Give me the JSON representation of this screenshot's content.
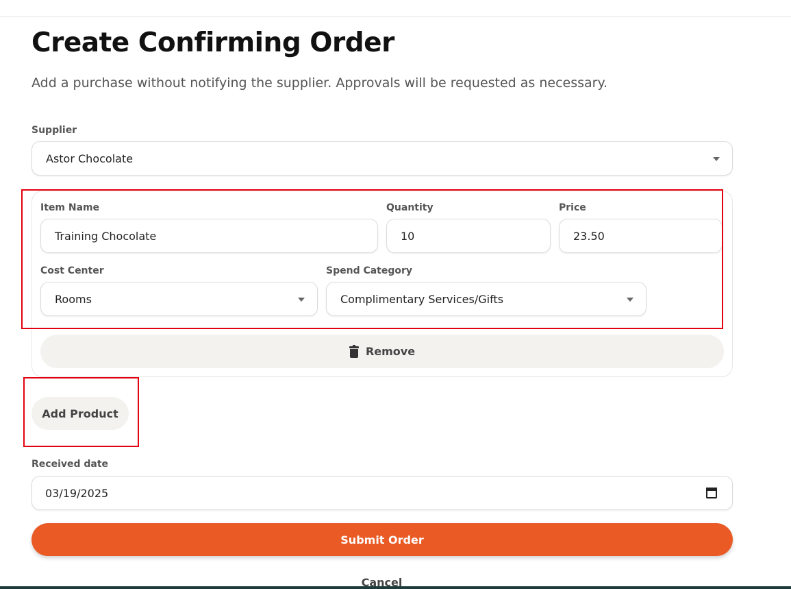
{
  "page": {
    "title": "Create Confirming Order",
    "subtitle": "Add a purchase without notifying the supplier. Approvals will be requested as necessary."
  },
  "supplier": {
    "label": "Supplier",
    "value": "Astor Chocolate"
  },
  "product": {
    "item_name_label": "Item Name",
    "item_name_value": "Training Chocolate",
    "quantity_label": "Quantity",
    "quantity_value": "10",
    "price_label": "Price",
    "price_value": "23.50",
    "cost_center_label": "Cost Center",
    "cost_center_value": "Rooms",
    "spend_category_label": "Spend Category",
    "spend_category_value": "Complimentary Services/Gifts",
    "remove_label": "Remove"
  },
  "actions": {
    "add_product_label": "Add Product",
    "submit_label": "Submit Order",
    "cancel_label": "Cancel"
  },
  "received": {
    "label": "Received date",
    "value": "03/19/2025"
  },
  "icons": {
    "remove": "trash-icon",
    "date": "calendar-icon",
    "dropdown": "chevron-down-icon"
  },
  "colors": {
    "accent": "#e95a24",
    "highlight": "#e3000f",
    "secondary_button_bg": "#f3f2ef"
  }
}
